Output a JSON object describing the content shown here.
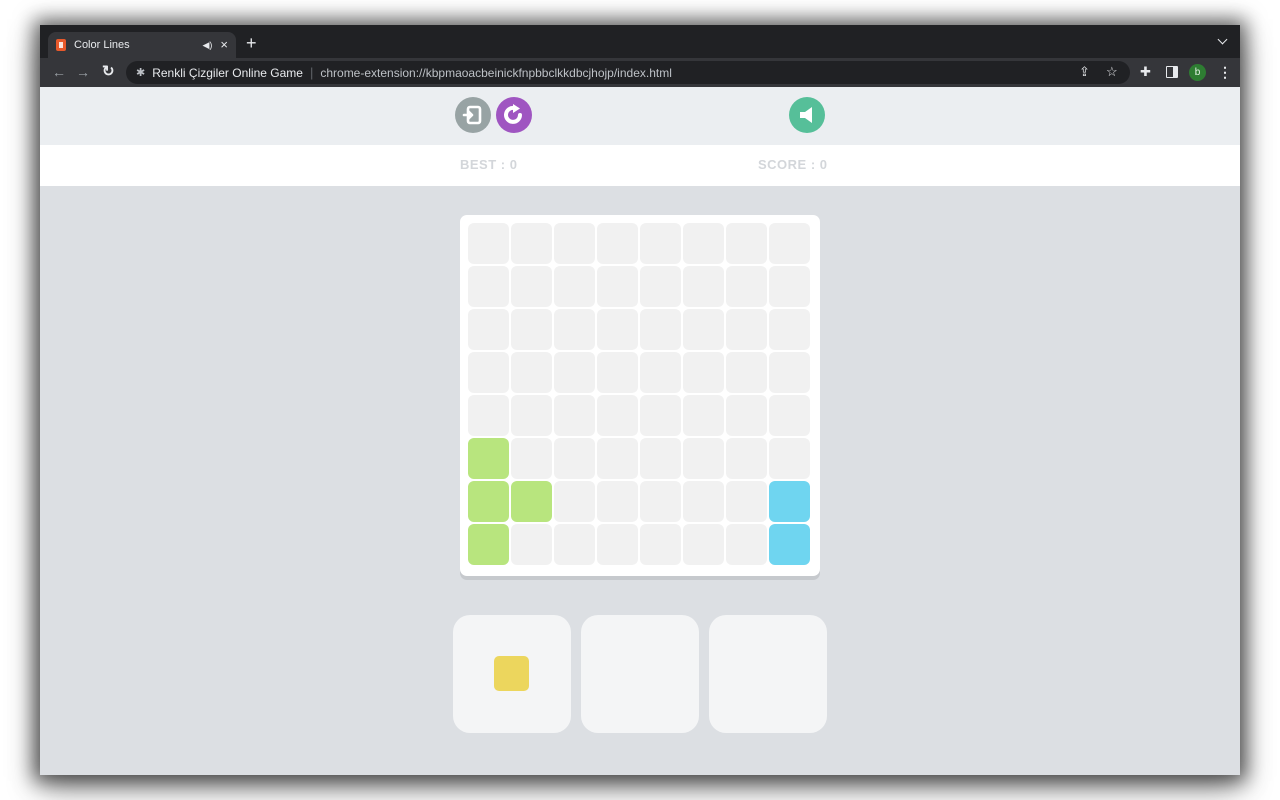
{
  "browser": {
    "tab": {
      "title": "Color Lines",
      "audio_icon": "speaker-icon",
      "close_label": "×"
    },
    "new_tab_label": "+",
    "omnibox": {
      "site_name": "Renkli Çizgiler Online Game",
      "url": "chrome-extension://kbpmaoacbeinickfnpbbclkkdbcjhojp/index.html"
    },
    "profile_initial": "b"
  },
  "game": {
    "buttons": {
      "exit": "exit-icon",
      "restart": "restart-icon",
      "sound": "sound-icon"
    },
    "best_label": "BEST : 0",
    "score_label": "SCORE : 0",
    "board": {
      "rows": 8,
      "cols": 8,
      "filled_cells": [
        {
          "row": 6,
          "col": 1,
          "color": "green"
        },
        {
          "row": 7,
          "col": 1,
          "color": "green"
        },
        {
          "row": 7,
          "col": 2,
          "color": "green"
        },
        {
          "row": 8,
          "col": 1,
          "color": "green"
        },
        {
          "row": 7,
          "col": 8,
          "color": "blue"
        },
        {
          "row": 8,
          "col": 8,
          "color": "blue"
        }
      ]
    },
    "pieces": [
      {
        "slot": 1,
        "color": "yellow",
        "shape": "single"
      },
      {
        "slot": 2,
        "empty": true
      },
      {
        "slot": 3,
        "empty": true
      }
    ],
    "colors": {
      "green": "#b8e57e",
      "blue": "#6fd5f0",
      "yellow": "#ecd65d",
      "exit_button": "#98a3a4",
      "restart_button": "#9f55c1",
      "sound_button": "#56bf99",
      "empty_cell": "#f1f1f1"
    }
  }
}
